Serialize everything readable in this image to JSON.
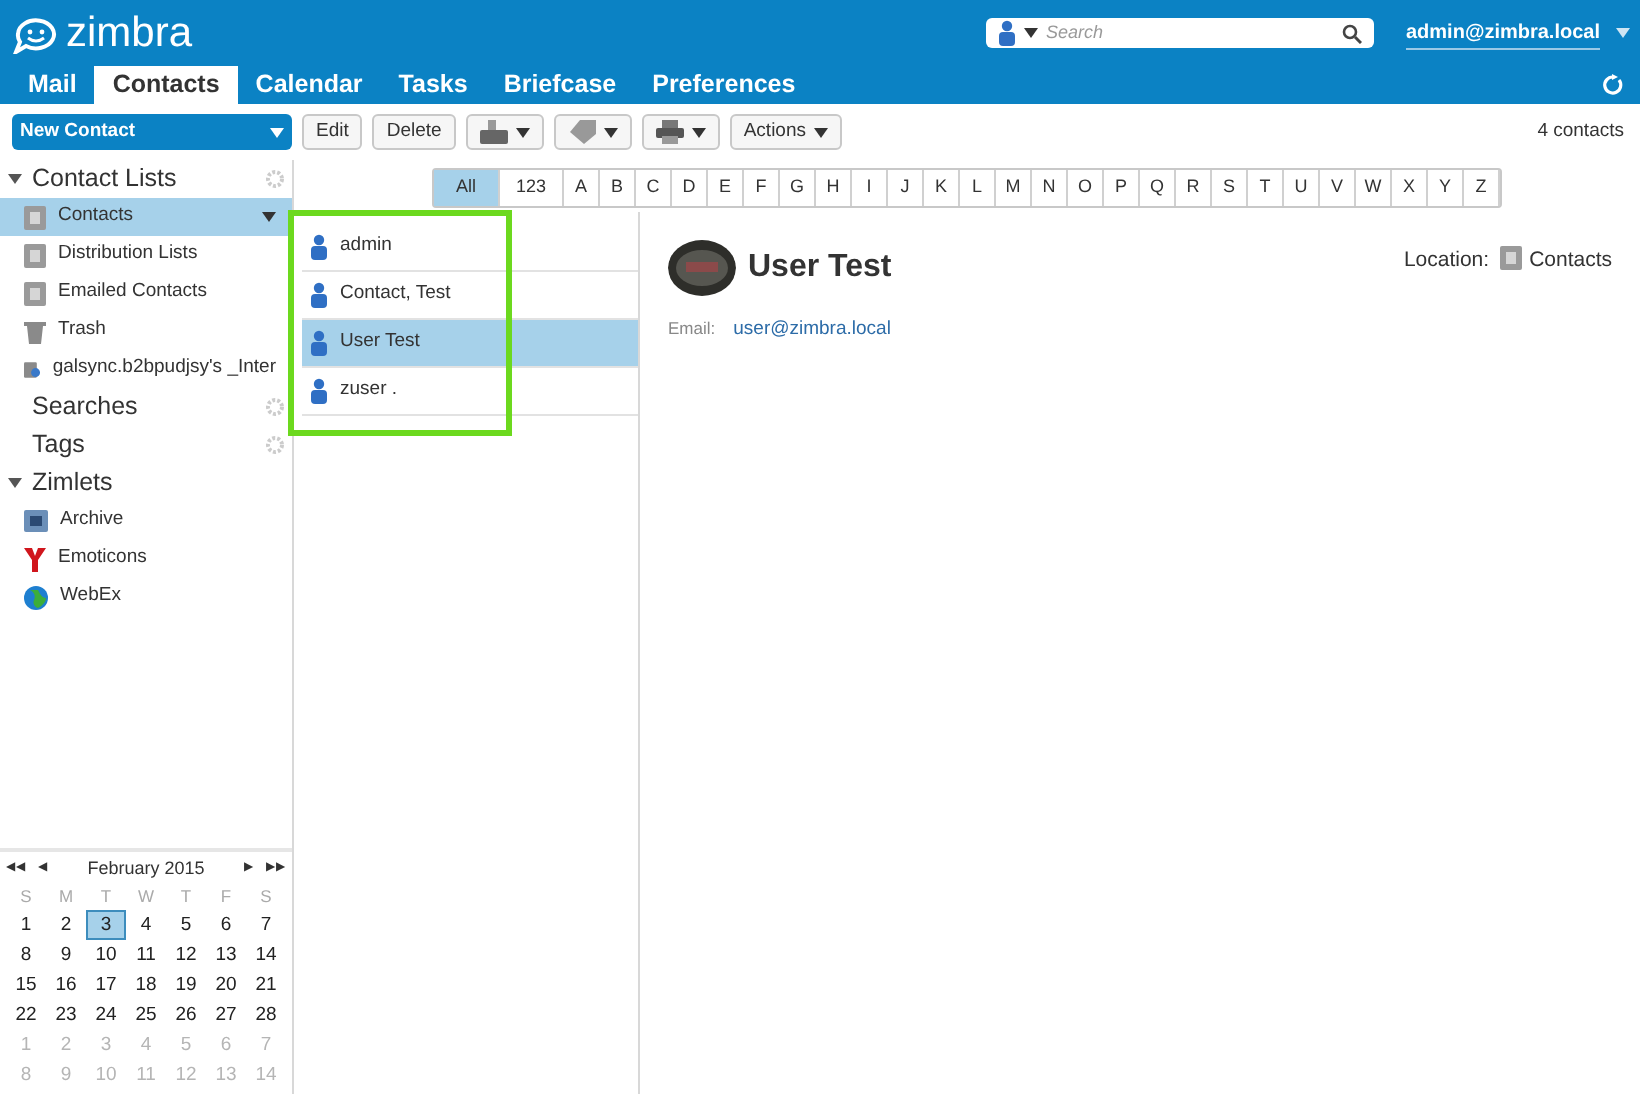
{
  "header": {
    "logo": "zimbra",
    "search": {
      "placeholder": "Search"
    },
    "user": "admin@zimbra.local"
  },
  "tabs": [
    {
      "label": "Mail",
      "selected": false
    },
    {
      "label": "Contacts",
      "selected": true
    },
    {
      "label": "Calendar",
      "selected": false
    },
    {
      "label": "Tasks",
      "selected": false
    },
    {
      "label": "Briefcase",
      "selected": false
    },
    {
      "label": "Preferences",
      "selected": false
    }
  ],
  "toolbar": {
    "new_button": "New Contact",
    "buttons": [
      {
        "kind": "text",
        "label": "Edit"
      },
      {
        "kind": "text",
        "label": "Delete"
      },
      {
        "kind": "tray"
      },
      {
        "kind": "tag"
      },
      {
        "kind": "print"
      },
      {
        "kind": "menu",
        "label": "Actions"
      }
    ],
    "count": "4 contacts"
  },
  "sidebar": {
    "sections": [
      {
        "title": "Contact Lists",
        "expandable": true,
        "items": [
          {
            "label": "Contacts",
            "kind": "book",
            "selected": true
          },
          {
            "label": "Distribution Lists",
            "kind": "book",
            "selected": false
          },
          {
            "label": "Emailed Contacts",
            "kind": "book",
            "selected": false
          },
          {
            "label": "Trash",
            "kind": "trash",
            "selected": false
          },
          {
            "label": "galsync.b2bpudjsy's _Inter",
            "kind": "gal",
            "selected": false
          }
        ]
      },
      {
        "title": "Searches",
        "expandable": false
      },
      {
        "title": "Tags",
        "expandable": false
      },
      {
        "title": "Zimlets",
        "expandable": true,
        "items": [
          {
            "label": "Archive",
            "kind": "archive",
            "selected": false
          },
          {
            "label": "Emoticons",
            "kind": "y",
            "selected": false
          },
          {
            "label": "WebEx",
            "kind": "globe",
            "selected": false
          }
        ]
      }
    ]
  },
  "calendar": {
    "nav": [
      "◀◀",
      "◀",
      "▶",
      "▶▶"
    ],
    "title": "February 2015",
    "weekdays": [
      "S",
      "M",
      "T",
      "W",
      "T",
      "F",
      "S"
    ],
    "weeks": [
      [
        {
          "day": "1",
          "other_month": false,
          "selected": false
        },
        {
          "day": "2",
          "other_month": false,
          "selected": false
        },
        {
          "day": "3",
          "other_month": false,
          "selected": true
        },
        {
          "day": "4",
          "other_month": false,
          "selected": false
        },
        {
          "day": "5",
          "other_month": false,
          "selected": false
        },
        {
          "day": "6",
          "other_month": false,
          "selected": false
        },
        {
          "day": "7",
          "other_month": false,
          "selected": false
        }
      ],
      [
        {
          "day": "8",
          "other_month": false,
          "selected": false
        },
        {
          "day": "9",
          "other_month": false,
          "selected": false
        },
        {
          "day": "10",
          "other_month": false,
          "selected": false
        },
        {
          "day": "11",
          "other_month": false,
          "selected": false
        },
        {
          "day": "12",
          "other_month": false,
          "selected": false
        },
        {
          "day": "13",
          "other_month": false,
          "selected": false
        },
        {
          "day": "14",
          "other_month": false,
          "selected": false
        }
      ],
      [
        {
          "day": "15",
          "other_month": false,
          "selected": false
        },
        {
          "day": "16",
          "other_month": false,
          "selected": false
        },
        {
          "day": "17",
          "other_month": false,
          "selected": false
        },
        {
          "day": "18",
          "other_month": false,
          "selected": false
        },
        {
          "day": "19",
          "other_month": false,
          "selected": false
        },
        {
          "day": "20",
          "other_month": false,
          "selected": false
        },
        {
          "day": "21",
          "other_month": false,
          "selected": false
        }
      ],
      [
        {
          "day": "22",
          "other_month": false,
          "selected": false
        },
        {
          "day": "23",
          "other_month": false,
          "selected": false
        },
        {
          "day": "24",
          "other_month": false,
          "selected": false
        },
        {
          "day": "25",
          "other_month": false,
          "selected": false
        },
        {
          "day": "26",
          "other_month": false,
          "selected": false
        },
        {
          "day": "27",
          "other_month": false,
          "selected": false
        },
        {
          "day": "28",
          "other_month": false,
          "selected": false
        }
      ],
      [
        {
          "day": "1",
          "other_month": true,
          "selected": false
        },
        {
          "day": "2",
          "other_month": true,
          "selected": false
        },
        {
          "day": "3",
          "other_month": true,
          "selected": false
        },
        {
          "day": "4",
          "other_month": true,
          "selected": false
        },
        {
          "day": "5",
          "other_month": true,
          "selected": false
        },
        {
          "day": "6",
          "other_month": true,
          "selected": false
        },
        {
          "day": "7",
          "other_month": true,
          "selected": false
        }
      ],
      [
        {
          "day": "8",
          "other_month": true,
          "selected": false
        },
        {
          "day": "9",
          "other_month": true,
          "selected": false
        },
        {
          "day": "10",
          "other_month": true,
          "selected": false
        },
        {
          "day": "11",
          "other_month": true,
          "selected": false
        },
        {
          "day": "12",
          "other_month": true,
          "selected": false
        },
        {
          "day": "13",
          "other_month": true,
          "selected": false
        },
        {
          "day": "14",
          "other_month": true,
          "selected": false
        }
      ]
    ]
  },
  "alphabet": [
    {
      "label": "All",
      "selected": true
    },
    {
      "label": "123",
      "selected": false
    },
    {
      "label": "A",
      "selected": false
    },
    {
      "label": "B",
      "selected": false
    },
    {
      "label": "C",
      "selected": false
    },
    {
      "label": "D",
      "selected": false
    },
    {
      "label": "E",
      "selected": false
    },
    {
      "label": "F",
      "selected": false
    },
    {
      "label": "G",
      "selected": false
    },
    {
      "label": "H",
      "selected": false
    },
    {
      "label": "I",
      "selected": false
    },
    {
      "label": "J",
      "selected": false
    },
    {
      "label": "K",
      "selected": false
    },
    {
      "label": "L",
      "selected": false
    },
    {
      "label": "M",
      "selected": false
    },
    {
      "label": "N",
      "selected": false
    },
    {
      "label": "O",
      "selected": false
    },
    {
      "label": "P",
      "selected": false
    },
    {
      "label": "Q",
      "selected": false
    },
    {
      "label": "R",
      "selected": false
    },
    {
      "label": "S",
      "selected": false
    },
    {
      "label": "T",
      "selected": false
    },
    {
      "label": "U",
      "selected": false
    },
    {
      "label": "V",
      "selected": false
    },
    {
      "label": "W",
      "selected": false
    },
    {
      "label": "X",
      "selected": false
    },
    {
      "label": "Y",
      "selected": false
    },
    {
      "label": "Z",
      "selected": false
    }
  ],
  "contact_list": {
    "highlighted": true,
    "items": [
      {
        "name": "admin",
        "selected": false
      },
      {
        "name": "Contact, Test",
        "selected": false
      },
      {
        "name": "User Test",
        "selected": true
      },
      {
        "name": "zuser .",
        "selected": false
      }
    ]
  },
  "detail": {
    "name": "User Test",
    "location_label": "Location:",
    "location": "Contacts",
    "fields": [
      {
        "label": "Email:",
        "value": "user@zimbra.local"
      }
    ]
  }
}
